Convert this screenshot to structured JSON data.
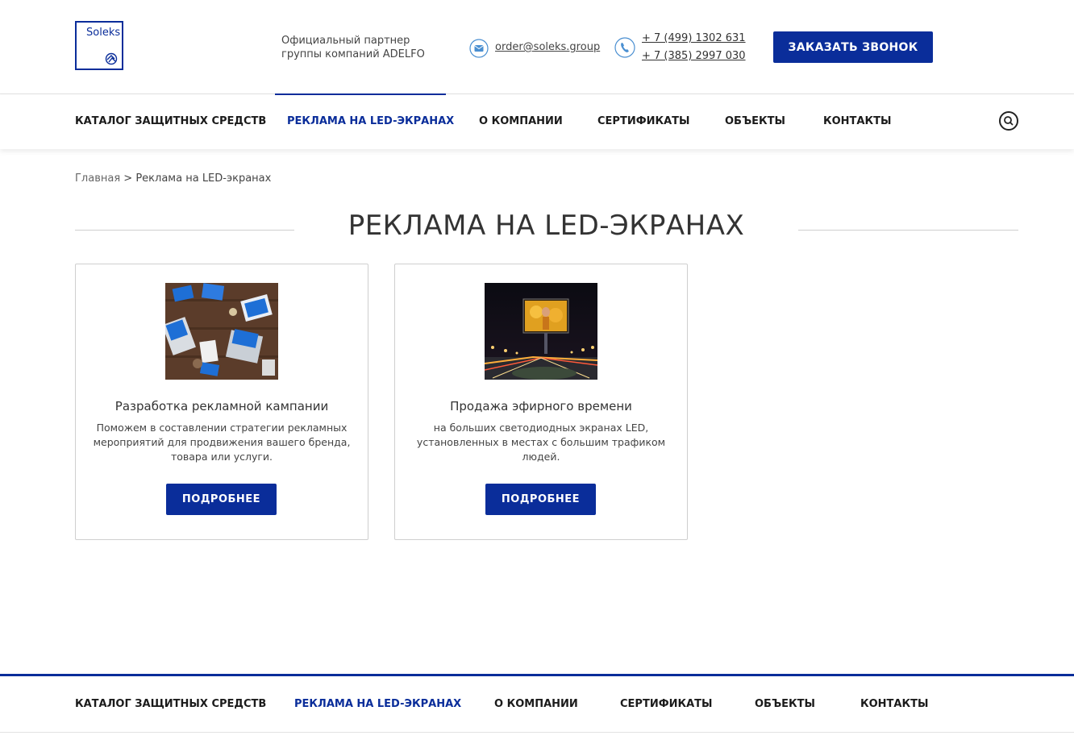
{
  "colors": {
    "brand": "#0a2d9a",
    "text": "#333333",
    "border": "#cfcfcf"
  },
  "header": {
    "logo_text": "Soleks",
    "partner_line1": "Официальный партнер",
    "partner_line2": "группы компаний ADELFO",
    "email": "order@soleks.group",
    "phone1": "+ 7 (499) 1302 631",
    "phone2": "+ 7 (385) 2997 030",
    "callback_label": "ЗАКАЗАТЬ ЗВОНОК",
    "icons": {
      "email": "email-icon",
      "phone": "phone-icon"
    }
  },
  "nav": {
    "items": [
      {
        "label": "КАТАЛОГ ЗАЩИТНЫХ СРЕДСТВ"
      },
      {
        "label": "РЕКЛАМА НА LED-ЭКРАНАХ",
        "active": true
      },
      {
        "label": "О КОМПАНИИ"
      },
      {
        "label": "СЕРТИФИКАТЫ"
      },
      {
        "label": "ОБЪЕКТЫ"
      },
      {
        "label": "КОНТАКТЫ"
      }
    ],
    "search_icon": "search-icon"
  },
  "breadcrumb": {
    "home": "Главная",
    "separator": ">",
    "current": "Реклама на LED-экранах"
  },
  "page": {
    "title": "РЕКЛАМА НА LED-ЭКРАНАХ"
  },
  "cards": [
    {
      "title": "Разработка рекламной кампании",
      "description": "Поможем в составлении стратегии рекламных мероприятий для продвижения вашего бренда, товара или услуги.",
      "button": "ПОДРОБНЕЕ",
      "image": "laptops-on-table"
    },
    {
      "title": "Продажа эфирного времени",
      "description": "на больших светодиодных экранах LED, установленных в местах с большим трафиком людей.",
      "button": "ПОДРОБНЕЕ",
      "image": "billboard-night-road"
    }
  ],
  "footer": {
    "items": [
      {
        "label": "КАТАЛОГ ЗАЩИТНЫХ СРЕДСТВ"
      },
      {
        "label": "РЕКЛАМА НА LED-ЭКРАНАХ",
        "active": true
      },
      {
        "label": "О КОМПАНИИ"
      },
      {
        "label": "СЕРТИФИКАТЫ"
      },
      {
        "label": "ОБЪЕКТЫ"
      },
      {
        "label": "КОНТАКТЫ"
      }
    ]
  }
}
